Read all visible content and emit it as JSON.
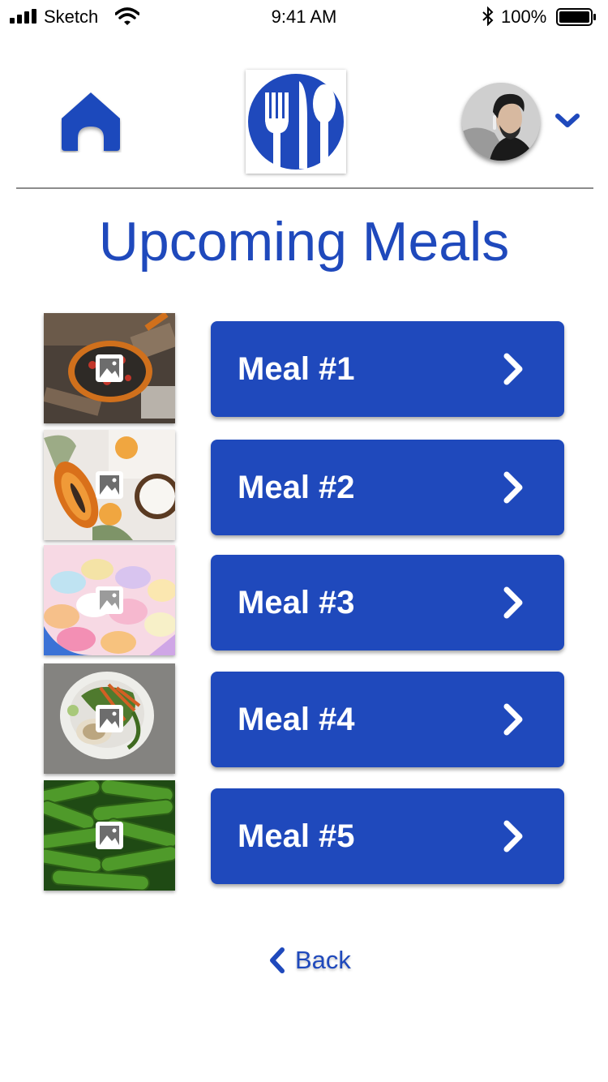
{
  "status_bar": {
    "carrier": "Sketch",
    "time": "9:41 AM",
    "battery": "100%"
  },
  "header": {
    "home_icon": "home-icon",
    "logo_icon": "fork-knife-spoon-icon",
    "avatar": "user-avatar",
    "menu_icon": "chevron-down-icon"
  },
  "page": {
    "title": "Upcoming Meals"
  },
  "meals": [
    {
      "label": "Meal #1",
      "image": "campfire-pan-vegetables"
    },
    {
      "label": "Meal #2",
      "image": "papaya-coconut"
    },
    {
      "label": "Meal #3",
      "image": "candy-hearts"
    },
    {
      "label": "Meal #4",
      "image": "salad-bowl"
    },
    {
      "label": "Meal #5",
      "image": "cucumbers"
    }
  ],
  "back": {
    "label": "Back",
    "icon": "chevron-left-icon"
  },
  "colors": {
    "accent": "#1f49bc",
    "button_text": "#ffffff",
    "divider": "#8c8c8c"
  }
}
